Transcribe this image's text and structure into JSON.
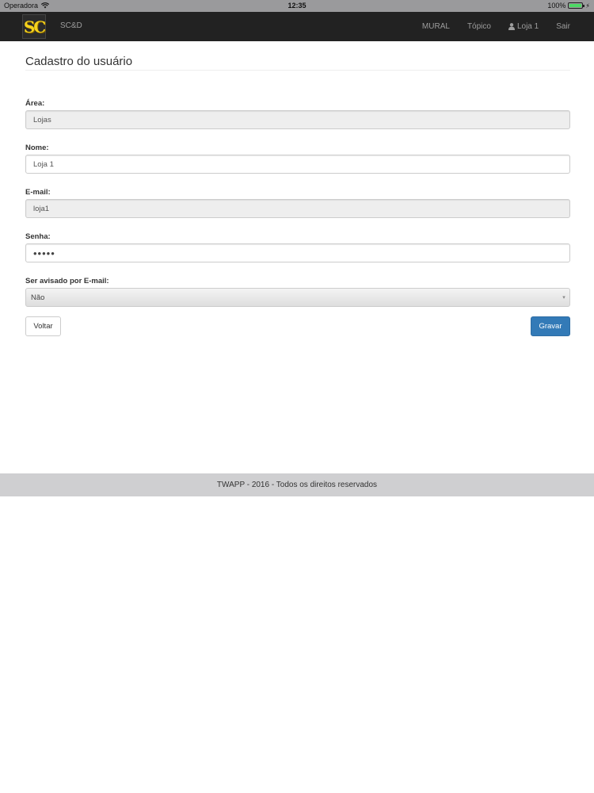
{
  "statusbar": {
    "carrier": "Operadora",
    "time": "12:35",
    "battery": "100%",
    "battery_level": 1.0
  },
  "navbar": {
    "logo_text": "SC",
    "brand": "SC&D",
    "links": {
      "mural": "MURAL",
      "topico": "Tópico",
      "user": "Loja 1",
      "sair": "Sair"
    },
    "user_icon": "user-icon"
  },
  "page": {
    "title": "Cadastro do usuário"
  },
  "form": {
    "area": {
      "label": "Área:",
      "value": "Lojas"
    },
    "nome": {
      "label": "Nome:",
      "value": "Loja 1"
    },
    "email": {
      "label": "E-mail:",
      "value": "loja1"
    },
    "senha": {
      "label": "Senha:",
      "value": "•••••"
    },
    "aviso": {
      "label": "Ser avisado por E-mail:",
      "value": "Não"
    }
  },
  "buttons": {
    "back": "Voltar",
    "save": "Gravar"
  },
  "footer": {
    "text": "TWAPP - 2016 - Todos os direitos reservados"
  },
  "colors": {
    "navbar": "#222222",
    "primary": "#337ab7",
    "logo": "#f5d21c",
    "footer": "#cfcfd1"
  }
}
